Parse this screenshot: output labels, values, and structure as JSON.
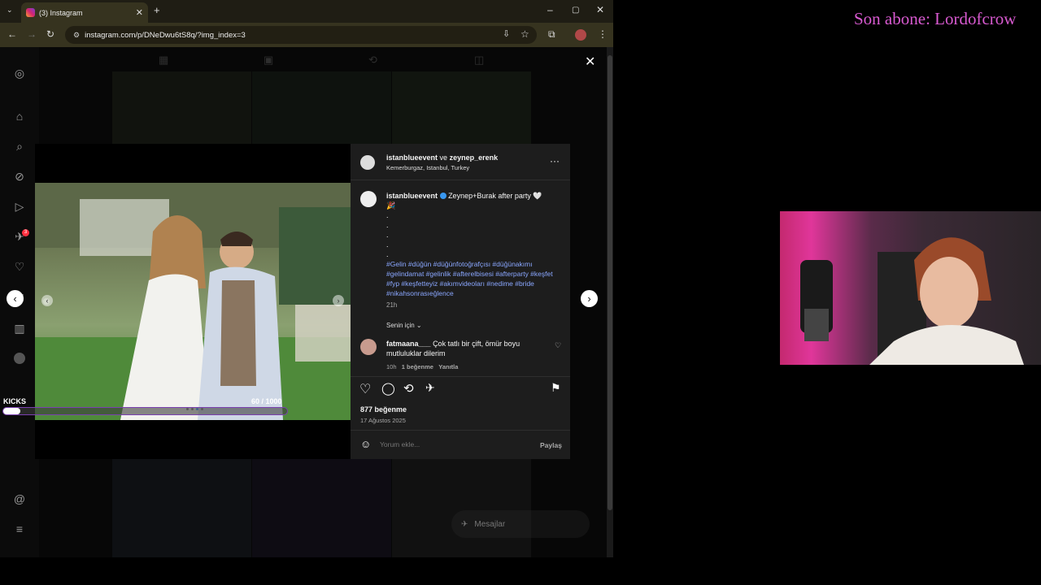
{
  "overlay_text": "Son abone: Lordofcrow",
  "browser": {
    "tab_title": "(3) Instagram",
    "url": "instagram.com/p/DNeDwu6tS8q/?img_index=3"
  },
  "post": {
    "header_user1": "istanblueevent",
    "header_conj": "ve",
    "header_user2": "zeynep_erenk",
    "location": "Kemerburgaz, Istanbul, Turkey",
    "caption_user": "istanblueevent",
    "caption_text": "Zeynep+Burak after party 🤍",
    "caption_emoji": "🎉",
    "caption_dots": ".",
    "hashtags": "#Gelin #düğün #düğünfotoğrafçısı #düğünakımı #gelindamat #gelinlik #afterelbisesi #afterparty #keşfet #fyp #keşfetteyiz #akımvideoları #nedime #bride #nikahsonrasıeğlence",
    "caption_time": "21h",
    "sort_label": "Senin için",
    "comment_user": "fatmaana___",
    "comment_text": "Çok tatlı bir çift, ömür boyu mutluluklar dilerim",
    "comment_time": "10h",
    "comment_likes": "1 beğenme",
    "comment_reply": "Yanıtla",
    "likes": "877 beğenme",
    "date": "17 Ağustos 2025",
    "comment_placeholder": "Yorum ekle...",
    "share_label": "Paylaş"
  },
  "kicks": {
    "label": "KICKS",
    "count": "60 / 1000",
    "progress": 0.06
  },
  "messages_label": "Mesajlar",
  "messages_badge": "3",
  "sidebar_badge": "3",
  "icons": [
    "instagram-icon",
    "home-icon",
    "search-icon",
    "explore-icon",
    "reels-icon",
    "messages-icon",
    "heart-icon",
    "create-icon",
    "dashboard-icon",
    "profile-icon",
    "threads-icon",
    "menu-icon"
  ]
}
